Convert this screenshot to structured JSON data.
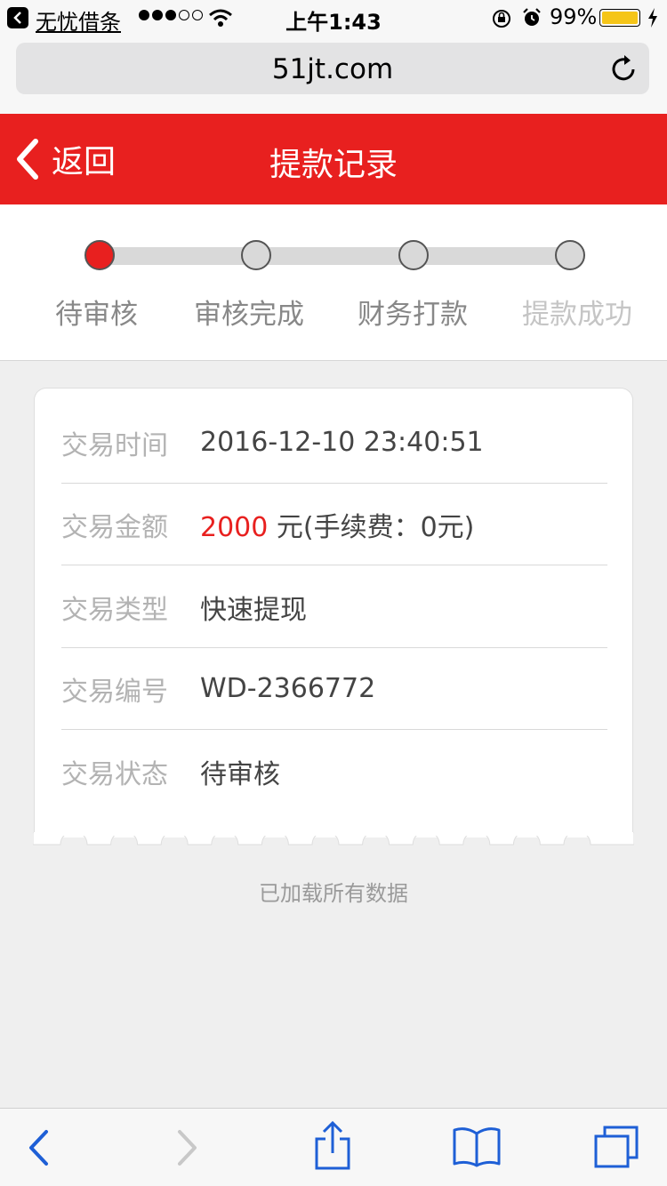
{
  "status_bar": {
    "back_app": "无忧借条",
    "time": "上午1:43",
    "battery": "99%",
    "battery_level": 0.99,
    "signal_bars_filled": 3,
    "signal_bars_total": 5
  },
  "browser": {
    "url": "51jt.com"
  },
  "header": {
    "back_label": "返回",
    "title": "提款记录"
  },
  "progress": {
    "steps": [
      {
        "label": "待审核",
        "active": true
      },
      {
        "label": "审核完成",
        "active": false
      },
      {
        "label": "财务打款",
        "active": false
      },
      {
        "label": "提款成功",
        "active": false
      }
    ]
  },
  "record": {
    "rows": [
      {
        "label": "交易时间",
        "value": "2016-12-10 23:40:51"
      },
      {
        "label": "交易金额",
        "amount": "2000",
        "value": " 元(手续费：0元)"
      },
      {
        "label": "交易类型",
        "value": "快速提现"
      },
      {
        "label": "交易编号",
        "value": "WD-2366772"
      },
      {
        "label": "交易状态",
        "value": "待审核"
      }
    ]
  },
  "footer_note": "已加载所有数据",
  "colors": {
    "brand_red": "#e8201f",
    "battery_yellow": "#f5c518",
    "ios_blue": "#1e5fd6"
  },
  "icons": [
    "back-chevron-icon",
    "wifi-icon",
    "rotation-lock-icon",
    "alarm-icon",
    "charging-bolt-icon",
    "reload-icon",
    "share-icon",
    "bookmarks-icon",
    "tabs-icon",
    "forward-icon"
  ]
}
